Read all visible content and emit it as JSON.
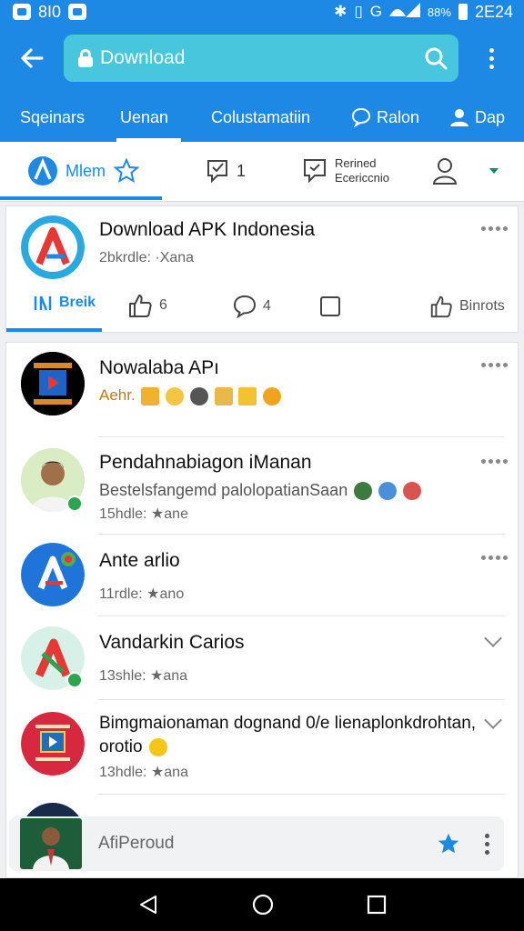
{
  "status_bar": {
    "left_text": "8I0",
    "battery_pct": "88%",
    "time": "2E24"
  },
  "app_bar": {
    "search_value": "Download"
  },
  "top_tabs": [
    {
      "label": "Sqeinars"
    },
    {
      "label": "Uenan",
      "active": true
    },
    {
      "label": "Colustamatiin"
    },
    {
      "label": "Ralon"
    },
    {
      "label": "Dap"
    }
  ],
  "sub_tabs": {
    "first_label": "Mlem",
    "inbox_count": "1",
    "refined_line1": "Rerined",
    "refined_line2": "Ecericcnio"
  },
  "featured": {
    "title": "Download APK Indonesia",
    "meta": "2bkrdle: ·Xana",
    "actions": {
      "brek": "Breik",
      "like_count": "6",
      "comment_count": "4",
      "share_label": "Binrots"
    }
  },
  "list": [
    {
      "title": "Nowalaba APı",
      "meta": "Aehr."
    },
    {
      "title": "Pendahnabiagon iManan",
      "meta": "Bestelsfangemd palolopatianSaan",
      "sub": "15hdle: ★ane"
    },
    {
      "title": "Ante arlio",
      "meta": "11rdle: ★ano"
    },
    {
      "title": "Vandarkin Carios",
      "meta": "13shle: ★ana"
    },
    {
      "title": "Bimgmaionaman dognand 0/e lienaplonkdrohtan,",
      "title2": "orotio",
      "meta": "13hdle: ★ana"
    }
  ],
  "mini_player": {
    "title": "AfiPeroud"
  },
  "colors": {
    "primary": "#1e88e5",
    "search_bg": "#48c6dd",
    "star": "#1e88e5"
  }
}
